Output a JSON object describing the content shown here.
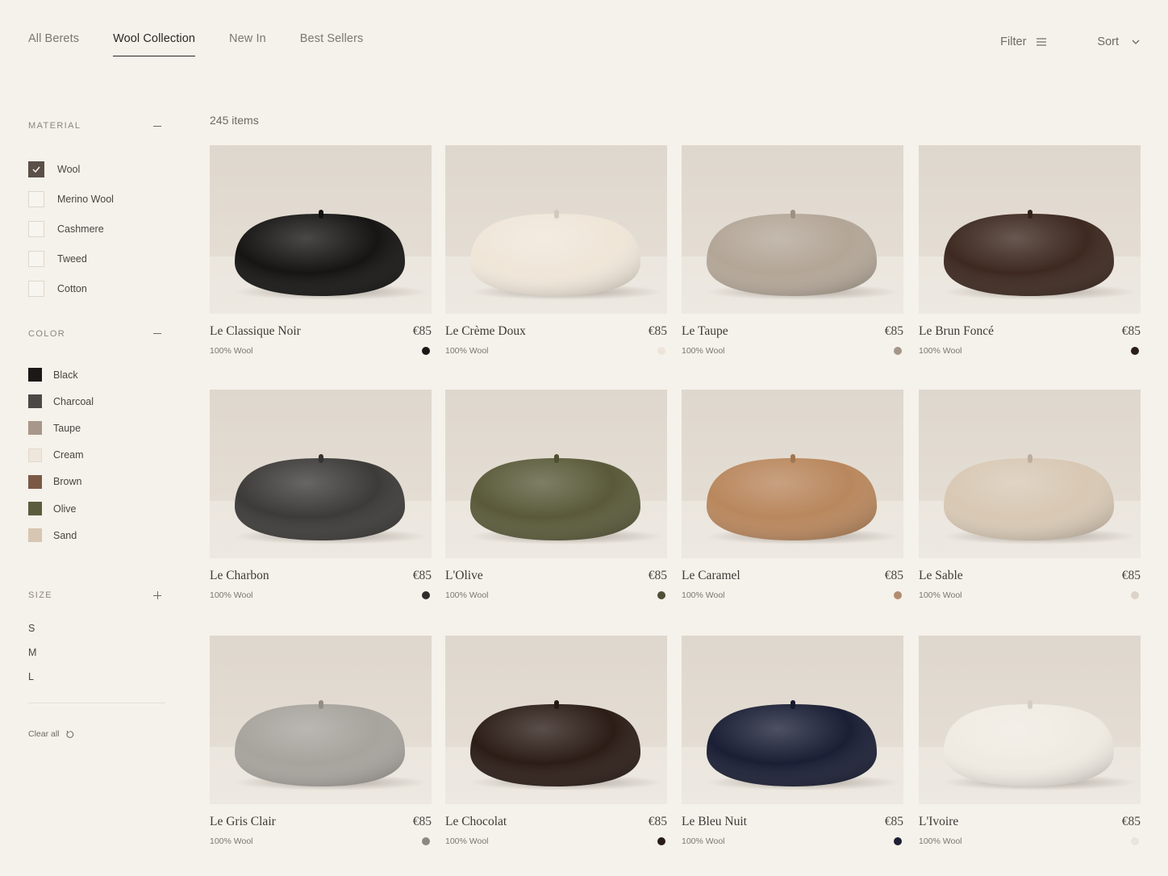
{
  "nav": {
    "tabs": [
      {
        "label": "All Berets"
      },
      {
        "label": "Wool Collection",
        "active": true
      },
      {
        "label": "New In"
      },
      {
        "label": "Best Sellers"
      }
    ],
    "filter_label": "Filter",
    "sort_label": "Sort"
  },
  "sidebar": {
    "material": {
      "title": "MATERIAL",
      "items": [
        {
          "label": "Wool",
          "checked": true
        },
        {
          "label": "Merino Wool",
          "checked": false
        },
        {
          "label": "Cashmere",
          "checked": false
        },
        {
          "label": "Tweed",
          "checked": false
        },
        {
          "label": "Cotton",
          "checked": false
        }
      ]
    },
    "color": {
      "title": "COLOR",
      "items": [
        {
          "label": "Black",
          "swatch": "#1b1917"
        },
        {
          "label": "Charcoal",
          "swatch": "#4b4845"
        },
        {
          "label": "Taupe",
          "swatch": "#a8968a"
        },
        {
          "label": "Cream",
          "swatch": "#efe7dc"
        },
        {
          "label": "Brown",
          "swatch": "#7a5a45"
        },
        {
          "label": "Olive",
          "swatch": "#5b5c3e"
        },
        {
          "label": "Sand",
          "swatch": "#d6c6b2"
        }
      ]
    },
    "size": {
      "title": "SIZE",
      "items": [
        "S",
        "M",
        "L"
      ]
    },
    "clear_label": "Clear all"
  },
  "results": {
    "count_label": "245 items"
  },
  "products": [
    {
      "name": "Le Classique Noir",
      "price": "€85",
      "material": "100% Wool",
      "dot": "#1a1816",
      "beret": "#161514"
    },
    {
      "name": "Le Crème Doux",
      "price": "€85",
      "material": "100% Wool",
      "dot": "#ede5da",
      "beret": "#efe6d8"
    },
    {
      "name": "Le Taupe",
      "price": "€85",
      "material": "100% Wool",
      "dot": "#a4968a",
      "beret": "#b3a697"
    },
    {
      "name": "Le Brun Foncé",
      "price": "€85",
      "material": "100% Wool",
      "dot": "#2a1e19",
      "beret": "#3d2920"
    },
    {
      "name": "Le Charbon",
      "price": "€85",
      "material": "100% Wool",
      "dot": "#2f2d2b",
      "beret": "#3d3b39"
    },
    {
      "name": "L'Olive",
      "price": "€85",
      "material": "100% Wool",
      "dot": "#4f5037",
      "beret": "#5a5a3a"
    },
    {
      "name": "Le Caramel",
      "price": "€85",
      "material": "100% Wool",
      "dot": "#b28c6f",
      "beret": "#b9875d"
    },
    {
      "name": "Le Sable",
      "price": "€85",
      "material": "100% Wool",
      "dot": "#dcd4ca",
      "beret": "#d8c8b4"
    },
    {
      "name": "Le Gris Clair",
      "price": "€85",
      "material": "100% Wool",
      "dot": "#8c8884",
      "beret": "#a7a39d"
    },
    {
      "name": "Le Chocolat",
      "price": "€85",
      "material": "100% Wool",
      "dot": "#2a1d17",
      "beret": "#2c1d17"
    },
    {
      "name": "Le Bleu Nuit",
      "price": "€85",
      "material": "100% Wool",
      "dot": "#1e2035",
      "beret": "#1b1f35"
    },
    {
      "name": "L'Ivoire",
      "price": "€85",
      "material": "100% Wool",
      "dot": "#e9e4dc",
      "beret": "#f0ebe2"
    }
  ]
}
